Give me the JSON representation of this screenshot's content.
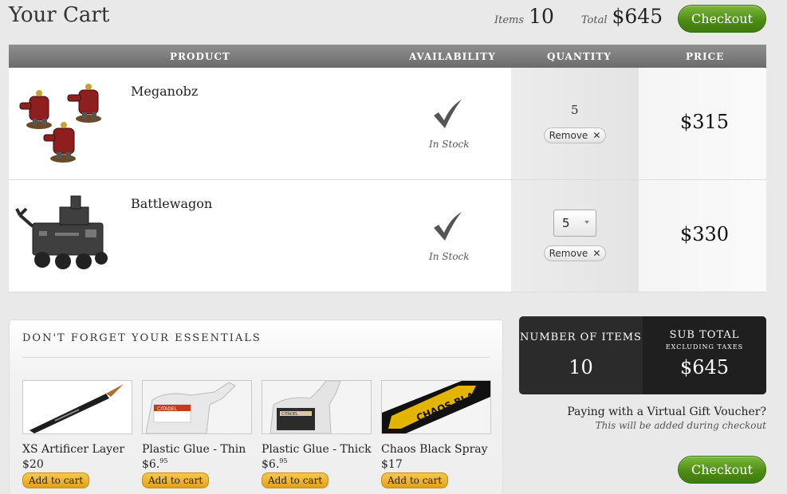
{
  "header": {
    "title": "Your Cart",
    "items_label": "Items",
    "items_value": "10",
    "total_label": "Total",
    "total_value": "$645",
    "checkout_label": "Checkout"
  },
  "table": {
    "columns": [
      "PRODUCT",
      "AVAILABILITY",
      "QUANTITY",
      "PRICE"
    ],
    "rows": [
      {
        "name": "Meganobz",
        "availability": "In Stock",
        "quantity": "5",
        "remove_label": "Remove",
        "remove_x": "✕",
        "price": "$315"
      },
      {
        "name": "Battlewagon",
        "availability": "In Stock",
        "quantity": "5",
        "remove_label": "Remove",
        "remove_x": "✕",
        "price": "$330"
      }
    ]
  },
  "essentials": {
    "title": "DON'T FORGET YOUR ESSENTIALS",
    "add_label": "Add to cart",
    "items": [
      {
        "name": "XS Artificer Layer",
        "price_main": "$20",
        "price_cents": "",
        "thumb_text": ""
      },
      {
        "name": "Plastic Glue - Thin",
        "price_main": "$6.",
        "price_cents": "95",
        "thumb_text": "CITADEL"
      },
      {
        "name": "Plastic Glue - Thick",
        "price_main": "$6.",
        "price_cents": "95",
        "thumb_text": "CITADEL"
      },
      {
        "name": "Chaos Black Spray",
        "price_main": "$17",
        "price_cents": "",
        "thumb_text": "CHAOS BLACK"
      }
    ]
  },
  "summary": {
    "items_label": "NUMBER OF ITEMS",
    "items_value": "10",
    "subtotal_label": "SUB TOTAL",
    "subtotal_sub": "EXCLUDING TAXES",
    "subtotal_value": "$645"
  },
  "voucher": {
    "question": "Paying with a Virtual Gift Voucher?",
    "note": "This will be added during checkout"
  },
  "footer": {
    "checkout_label": "Checkout"
  },
  "colors": {
    "checkout_green": "#4b8a13",
    "add_yellow": "#e2a11a",
    "header_gray": "#7a7a7a"
  }
}
